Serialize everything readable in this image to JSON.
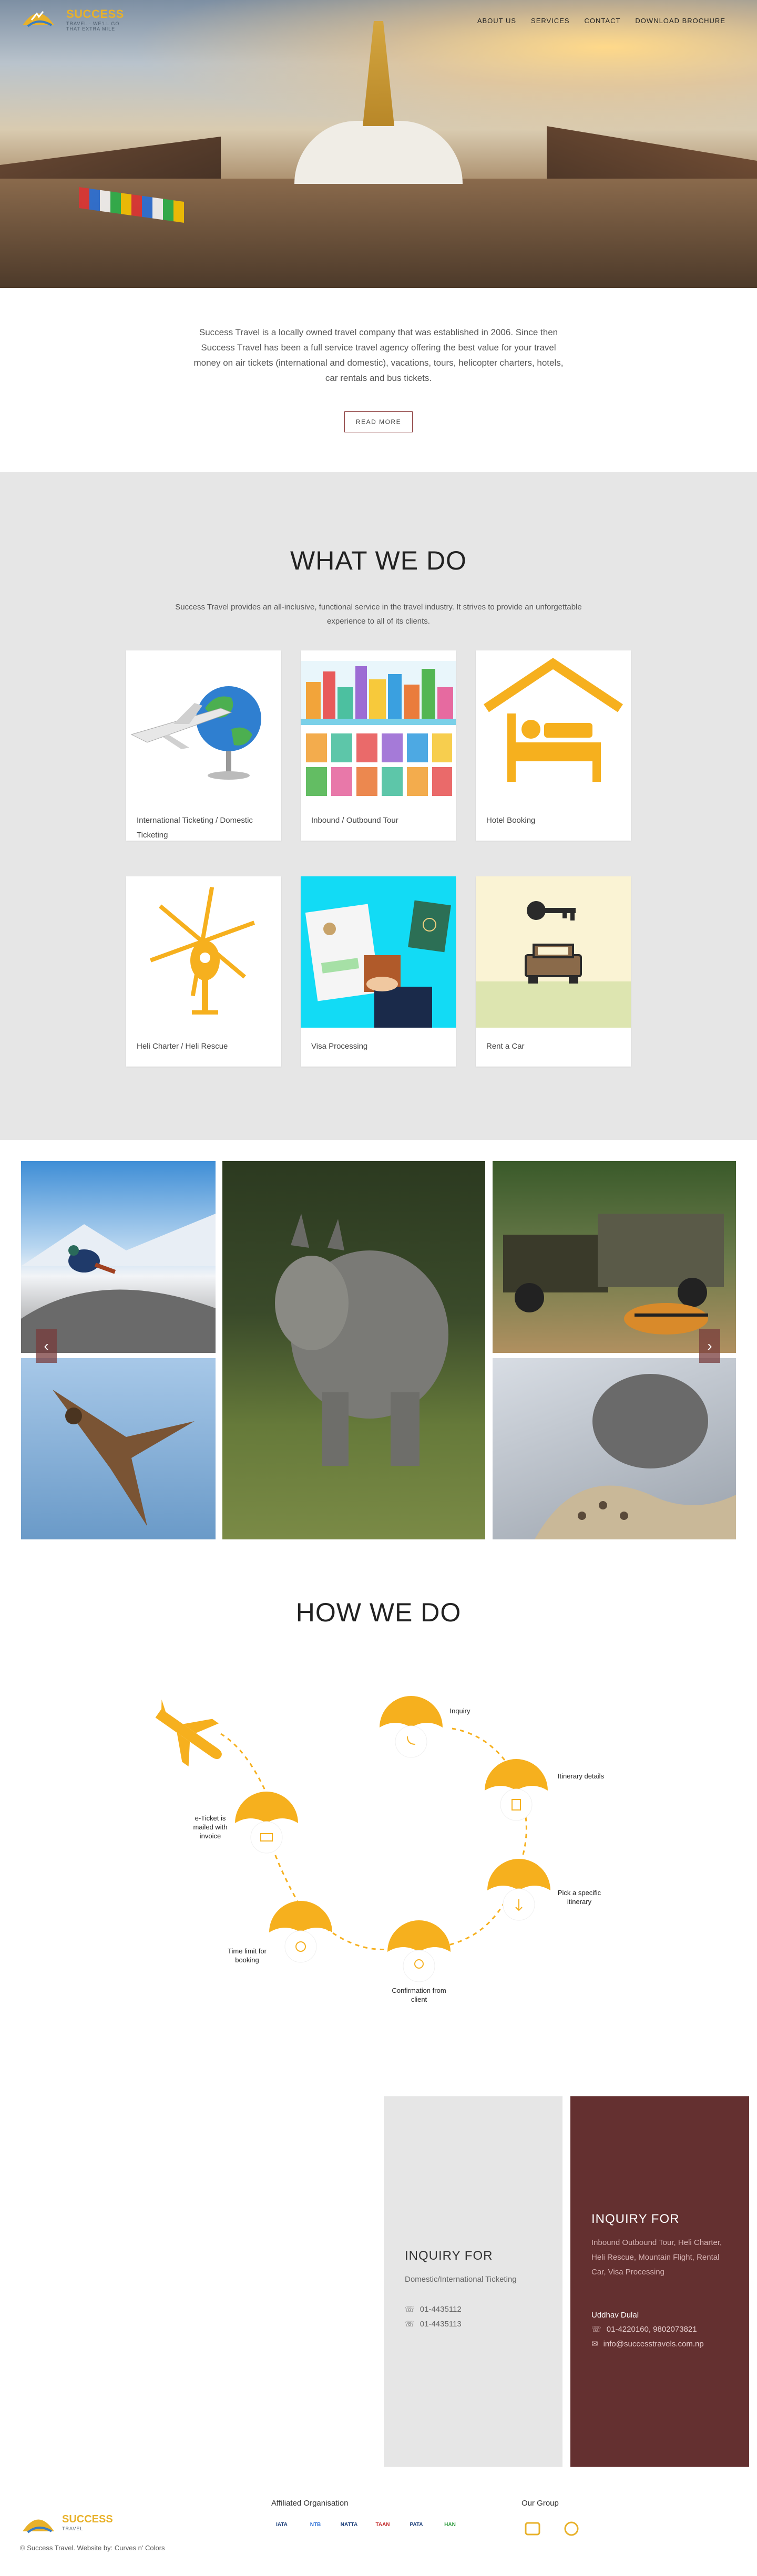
{
  "brand": {
    "name": "SUCCESS",
    "sub": "TRAVEL",
    "tagline": "WE'LL GO THAT EXTRA MILE",
    "accent": "#e8b12a",
    "maroon": "#643030"
  },
  "nav": {
    "items": [
      "ABOUT US",
      "SERVICES",
      "CONTACT",
      "DOWNLOAD BROCHURE"
    ]
  },
  "intro": {
    "text": "Success Travel is a locally owned travel company that was established in 2006. Since then Success Travel has been a full service travel agency offering the best value for your travel money on air tickets (international and domestic), vacations, tours, helicopter charters, hotels, car rentals and bus tickets.",
    "button": "READ MORE"
  },
  "what_we_do": {
    "title": "WHAT WE DO",
    "desc": "Success Travel provides an all-inclusive, functional service in the travel industry. It strives to provide an unforgettable experience to all of its clients.",
    "services": [
      {
        "label": "International Ticketing / Domestic Ticketing",
        "icon": "globe-plane-icon"
      },
      {
        "label": "Inbound / Outbound Tour",
        "icon": "city-skyline-icon"
      },
      {
        "label": "Hotel Booking",
        "icon": "hotel-bed-icon"
      },
      {
        "label": "Heli Charter / Heli Rescue",
        "icon": "helicopter-icon"
      },
      {
        "label": "Visa Processing",
        "icon": "passport-icon"
      },
      {
        "label": "Rent a Car",
        "icon": "car-key-icon"
      }
    ]
  },
  "gallery": {
    "prev": "‹",
    "next": "›"
  },
  "how_we_do": {
    "title": "HOW WE DO",
    "steps": [
      "Inquiry",
      "Itinerary details",
      "Pick a specific itinerary",
      "Confirmation from client",
      "Time limit for booking",
      "e-Ticket is mailed with invoice"
    ]
  },
  "inquiry": {
    "grey": {
      "title": "INQUIRY FOR",
      "subject": "Domestic/International Ticketing",
      "phones": [
        "01-4435112",
        "01-4435113"
      ]
    },
    "red": {
      "title": "INQUIRY FOR",
      "subject": "Inbound Outbound Tour, Heli Charter, Heli Rescue, Mountain Flight, Rental Car, Visa Processing",
      "person": "Uddhav Dulal",
      "phone": "01-4220160, 9802073821",
      "email": "info@successtravels.com.np"
    }
  },
  "footer": {
    "copyright": "© Success Travel. Website by: Curves n' Colors",
    "affiliated": "Affiliated Organisation",
    "group": "Our Group",
    "affiliates": [
      "IATA",
      "NTB",
      "NATTA",
      "TAAN",
      "PATA",
      "HAN"
    ]
  }
}
